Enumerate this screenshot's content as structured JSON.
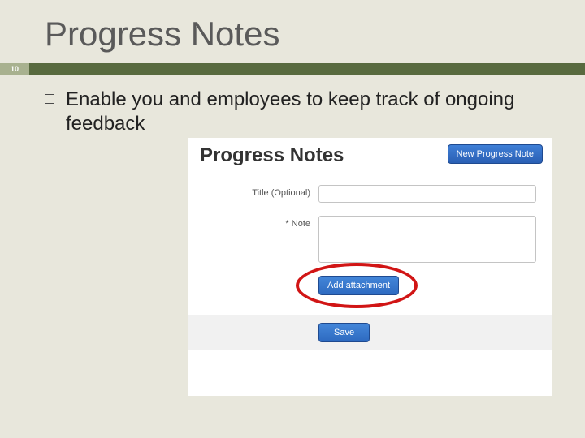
{
  "slide": {
    "title": "Progress Notes",
    "page_number": "10",
    "bullet_text": "Enable you and employees to keep track of ongoing feedback"
  },
  "panel": {
    "heading": "Progress Notes",
    "new_button": "New Progress Note",
    "title_label": "Title (Optional)",
    "note_label": "* Note",
    "attach_button": "Add attachment",
    "save_button": "Save"
  }
}
